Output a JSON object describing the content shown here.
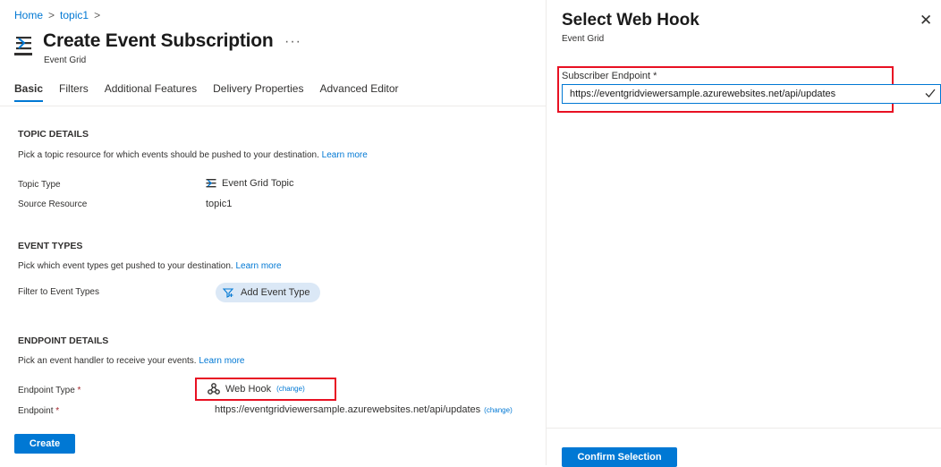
{
  "breadcrumb": {
    "home": "Home",
    "topic": "topic1",
    "separator": ">"
  },
  "header": {
    "title": "Create Event Subscription",
    "subtitle": "Event Grid",
    "more": "···"
  },
  "tabs": [
    {
      "label": "Basic",
      "active": true
    },
    {
      "label": "Filters"
    },
    {
      "label": "Additional Features"
    },
    {
      "label": "Delivery Properties"
    },
    {
      "label": "Advanced Editor"
    }
  ],
  "topic_details": {
    "title": "TOPIC DETAILS",
    "desc": "Pick a topic resource for which events should be pushed to your destination.",
    "learn_more": "Learn more",
    "topic_type_label": "Topic Type",
    "topic_type_value": "Event Grid Topic",
    "source_label": "Source Resource",
    "source_value": "topic1"
  },
  "event_types": {
    "title": "EVENT TYPES",
    "desc": "Pick which event types get pushed to your destination.",
    "learn_more": "Learn more",
    "filter_label": "Filter to Event Types",
    "add_button": "Add Event Type"
  },
  "endpoint_details": {
    "title": "ENDPOINT DETAILS",
    "desc": "Pick an event handler to receive your events.",
    "learn_more": "Learn more",
    "type_label": "Endpoint Type",
    "type_value": "Web Hook",
    "change": "(change)",
    "endpoint_label": "Endpoint",
    "endpoint_value": "https://eventgridviewersample.azurewebsites.net/api/updates",
    "required": "*"
  },
  "create_button": "Create",
  "panel": {
    "title": "Select Web Hook",
    "subtitle": "Event Grid",
    "field_label": "Subscriber Endpoint",
    "required": "*",
    "input_value": "https://eventgridviewersample.azurewebsites.net/api/updates",
    "confirm_button": "Confirm Selection",
    "close": "✕"
  },
  "colors": {
    "accent": "#0078d4",
    "highlight": "#e81123",
    "pill_bg": "#dbe8f6"
  }
}
